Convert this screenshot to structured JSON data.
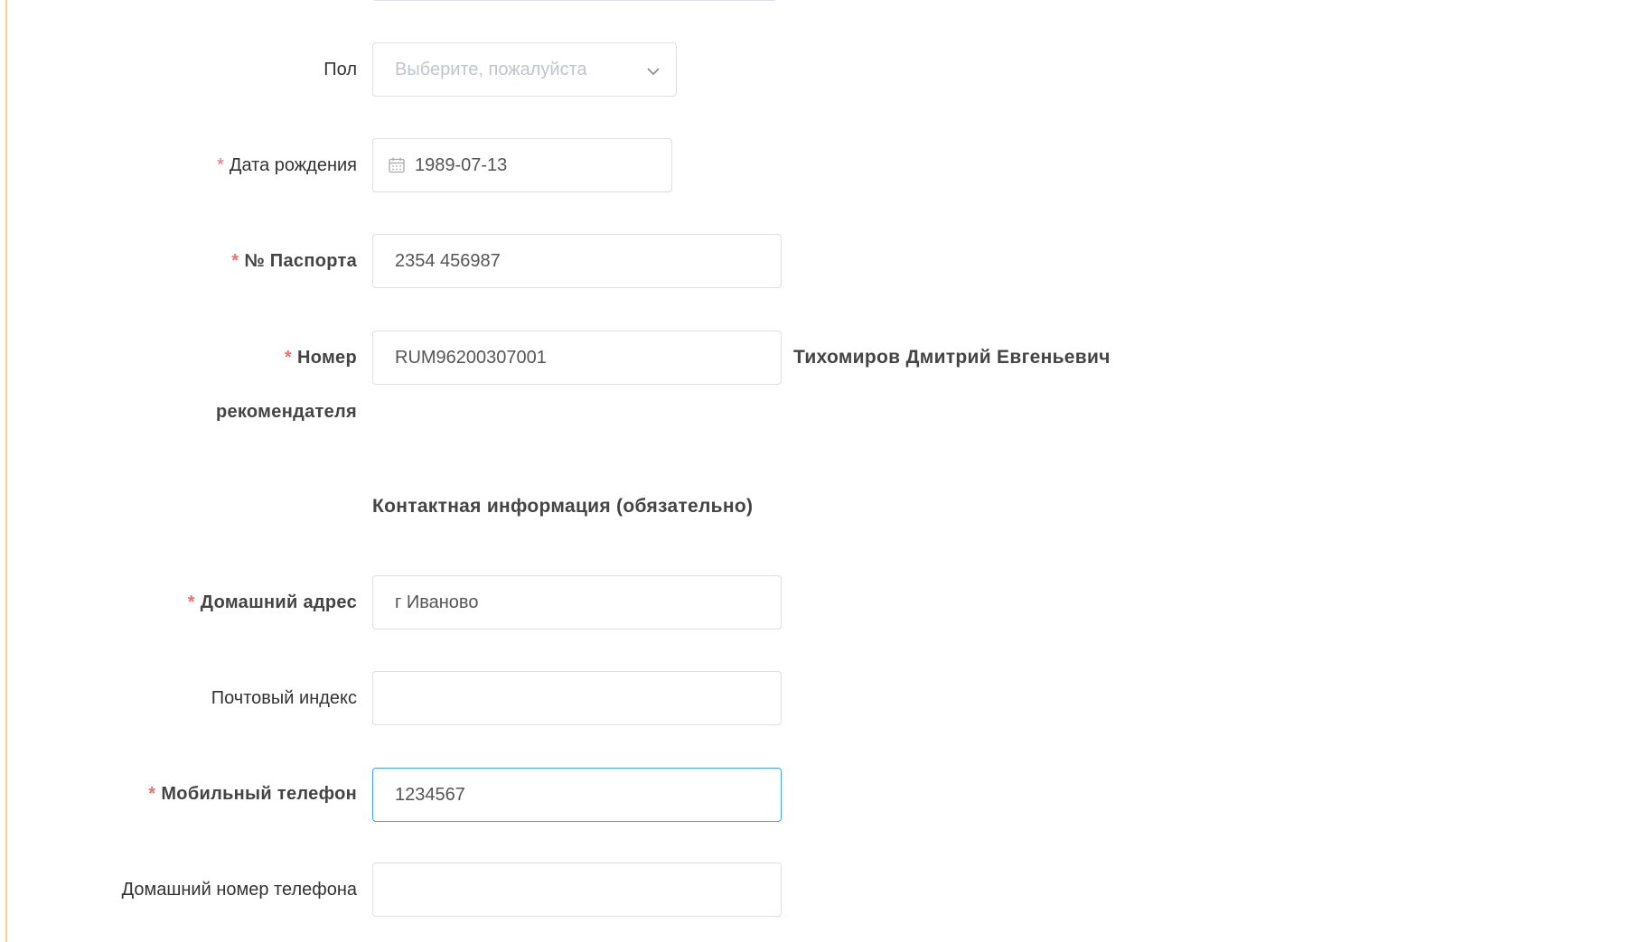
{
  "form": {
    "gender": {
      "label": "Пол",
      "placeholder": "Выберите, пожалуйста"
    },
    "birth_date": {
      "label": "Дата рождения",
      "value": "1989-07-13"
    },
    "passport": {
      "label": "№ Паспорта",
      "value": "2354 456987"
    },
    "referrer": {
      "label_line1": "Номер",
      "label_line2": "рекомендателя",
      "value": "RUM96200307001",
      "name": "Тихомиров Дмитрий Евгеньевич"
    },
    "contact_section_title": "Контактная информация (обязательно)",
    "home_address": {
      "label": "Домашний адрес",
      "value": "г Иваново"
    },
    "postal_code": {
      "label": "Почтовый индекс",
      "value": ""
    },
    "mobile_phone": {
      "label": "Мобильный телефон",
      "value": "1234567"
    },
    "home_phone": {
      "label": "Домашний номер телефона",
      "value": ""
    },
    "required_mark": "*"
  },
  "colors": {
    "required": "#f56c6c",
    "focus_border": "#409eff",
    "border": "#dcdfe6",
    "left_rule": "#f2d48a"
  }
}
